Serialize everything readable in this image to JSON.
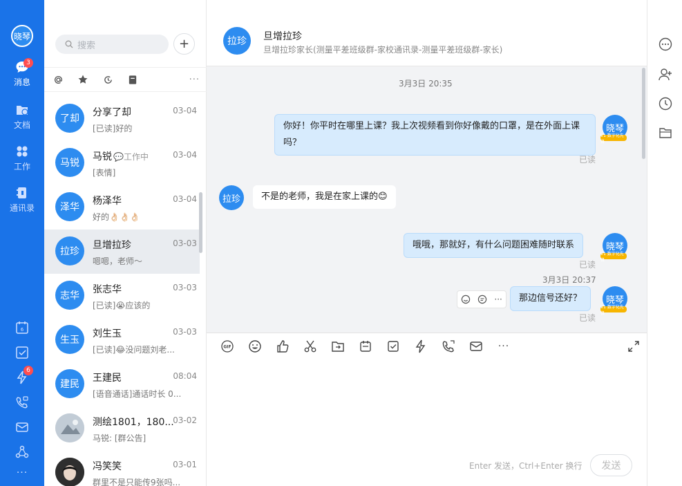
{
  "user": {
    "avatar_text": "晓琴"
  },
  "nav": {
    "items": [
      {
        "label": "消息",
        "badge": "3"
      },
      {
        "label": "文档"
      },
      {
        "label": "工作"
      },
      {
        "label": "通讯录"
      }
    ],
    "tools_badge": "6",
    "more": "···"
  },
  "search": {
    "placeholder": "搜索"
  },
  "add_button": "+",
  "filters": {
    "more": "···"
  },
  "conversations": [
    {
      "avatar": "了却",
      "name": "分享了却",
      "time": "03-04",
      "preview": "[已读]好的"
    },
    {
      "avatar": "马锐",
      "name": "马锐",
      "status": "💬工作中",
      "time": "03-04",
      "preview": "[表情]"
    },
    {
      "avatar": "泽华",
      "name": "杨泽华",
      "time": "03-04",
      "preview": "好的👌🏻👌🏻👌🏻"
    },
    {
      "avatar": "拉珍",
      "name": "旦增拉珍",
      "time": "03-03",
      "preview": "嗯嗯，老师～"
    },
    {
      "avatar": "志华",
      "name": "张志华",
      "time": "03-03",
      "preview": "[已读]😭应该的"
    },
    {
      "avatar": "生玉",
      "name": "刘生玉",
      "time": "03-03",
      "preview": "[已读]😂没问题刘老..."
    },
    {
      "avatar": "建民",
      "name": "王建民",
      "time": "08:04",
      "preview": "[语音通话]通话时长 0..."
    },
    {
      "avatar": "",
      "name": "测绘1801，180...",
      "time": "03-02",
      "preview": "马锐: [群公告]"
    },
    {
      "avatar": "",
      "name": "冯笑笑",
      "time": "03-01",
      "preview": "群里不是只能传9张吗..."
    }
  ],
  "chat": {
    "avatar": "拉珍",
    "title": "旦增拉珍",
    "subtitle": "旦增拉珍家长(测量平差班级群-家校通讯录-测量平差班级群-家长)",
    "timestamp1": "3月3日 20:35",
    "timestamp2": "3月3日 20:37",
    "my_avatar": "晓琴",
    "vip_tag": "V1 数字化先锋",
    "messages": [
      {
        "from": "me",
        "text": "你好！你平时在哪里上课？我上次视频看到你好像戴的口罩，是在外面上课吗？",
        "read": "已读"
      },
      {
        "from": "other",
        "text": "不是的老师，我是在家上课的😊"
      },
      {
        "from": "me",
        "text": "哦哦，那就好，有什么问题困难随时联系",
        "read": "已读"
      },
      {
        "from": "me",
        "text": "那边信号还好？",
        "read": "已读"
      }
    ],
    "msg_tools_more": "···"
  },
  "composer": {
    "gif": "GIF",
    "more": "···",
    "hint": "Enter 发送，Ctrl+Enter 换行",
    "send_label": "发送"
  }
}
